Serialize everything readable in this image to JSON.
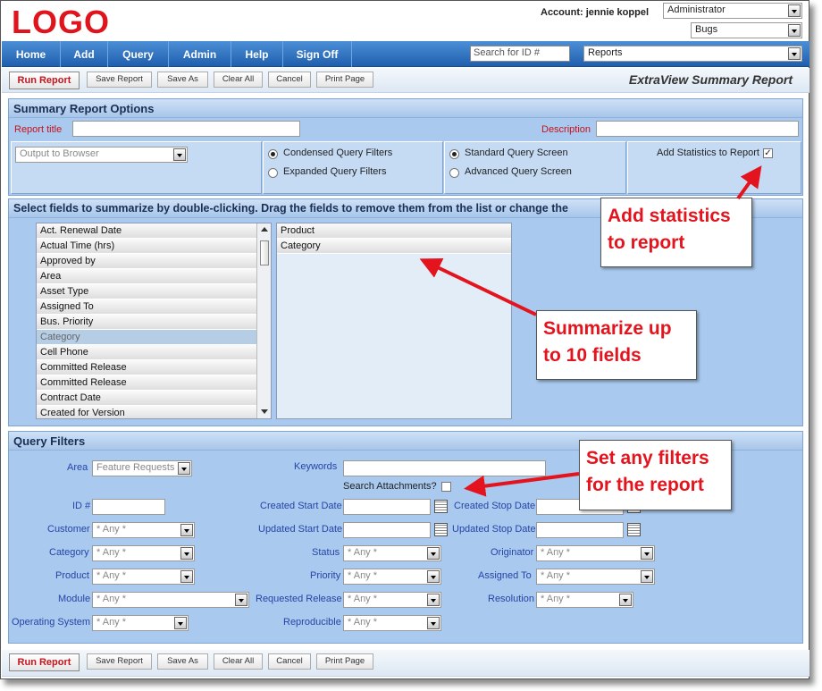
{
  "header": {
    "logo": "LOGO",
    "account": "Account: jennie koppel",
    "role": "Administrator",
    "project": "Bugs"
  },
  "nav": {
    "items": [
      "Home",
      "Add",
      "Query",
      "Admin",
      "Help",
      "Sign Off"
    ],
    "search_placeholder": "Search for ID #",
    "reports": "Reports"
  },
  "toolbar": {
    "run": "Run Report",
    "save": "Save Report",
    "save_as": "Save As",
    "clear": "Clear All",
    "cancel": "Cancel",
    "print": "Print Page",
    "title": "ExtraView Summary Report"
  },
  "options": {
    "heading": "Summary Report Options",
    "report_title_label": "Report title",
    "description_label": "Description",
    "output": "Output to Browser",
    "condensed": "Condensed Query Filters",
    "expanded": "Expanded Query Filters",
    "standard": "Standard Query Screen",
    "advanced": "Advanced Query Screen",
    "add_stats": "Add Statistics to Report"
  },
  "fields": {
    "heading": "Select fields to summarize by double-clicking. Drag the fields to remove them from the list or change the",
    "available": [
      "Act. Renewal Date",
      "Actual Time (hrs)",
      "Approved by",
      "Area",
      "Asset Type",
      "Assigned To",
      "Bus. Priority",
      "Category",
      "Cell Phone",
      "Committed Release",
      "Committed Release",
      "Contract Date",
      "Created for Version"
    ],
    "selected": [
      "Product",
      "Category"
    ]
  },
  "filters": {
    "heading": "Query Filters",
    "area_label": "Area",
    "area_value": "Feature Requests",
    "keywords_label": "Keywords",
    "search_attachments": "Search Attachments?",
    "id_label": "ID #",
    "created_start": "Created Start Date",
    "created_stop": "Created Stop Date",
    "customer_label": "Customer",
    "updated_start": "Updated Start Date",
    "updated_stop": "Updated Stop Date",
    "category_label": "Category",
    "status_label": "Status",
    "originator_label": "Originator",
    "product_label": "Product",
    "priority_label": "Priority",
    "assigned_label": "Assigned To",
    "module_label": "Module",
    "requested_label": "Requested Release",
    "resolution_label": "Resolution",
    "os_label": "Operating System",
    "reproducible_label": "Reproducible",
    "any": "* Any *"
  },
  "callouts": {
    "stats_1": "Add statistics",
    "stats_2": "to report",
    "summ_1": "Summarize up",
    "summ_2": "to 10 fields",
    "filt_1": "Set any filters",
    "filt_2": "for the report"
  }
}
